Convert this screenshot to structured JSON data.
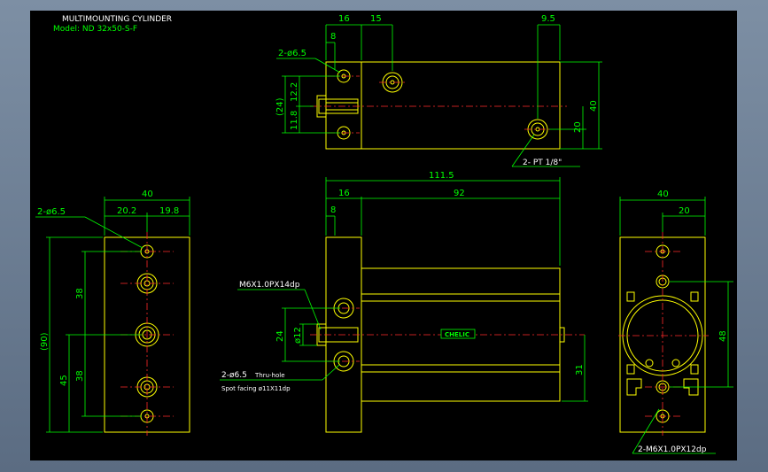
{
  "title": {
    "line1": "MULTIMOUNTING CYLINDER",
    "line2": "Model: ND 32x50-S-F"
  },
  "colors": {
    "background": "#000000",
    "outline": "#ffff00",
    "dimension": "#00ff00",
    "centerline": "#ff2a2a",
    "text": "#ffffff",
    "frame": "#6d7f95"
  },
  "top_view": {
    "dims": [
      "16",
      "15",
      "9.5",
      "8",
      "2-ø6.5",
      "12.2",
      "(24)",
      "11.8",
      "40",
      "20"
    ],
    "port_label": "2- PT 1/8\""
  },
  "front_view": {
    "dims": [
      "111.5",
      "16",
      "92",
      "8",
      "ø12",
      "24",
      "31"
    ],
    "thread_label": "M6X1.0PX14dp",
    "hole_label": "2-ø6.5",
    "thru_label": "Thru-hole",
    "spot_label": "Spot facing  ø11X11dp",
    "badge": "CHELIC"
  },
  "left_view": {
    "dims": [
      "40",
      "20.2",
      "19.8",
      "2-ø6.5",
      "38",
      "(90)",
      "45",
      "38"
    ]
  },
  "right_view": {
    "dims": [
      "40",
      "20",
      "48"
    ],
    "thread_label": "2-M6X1.0PX12dp"
  }
}
